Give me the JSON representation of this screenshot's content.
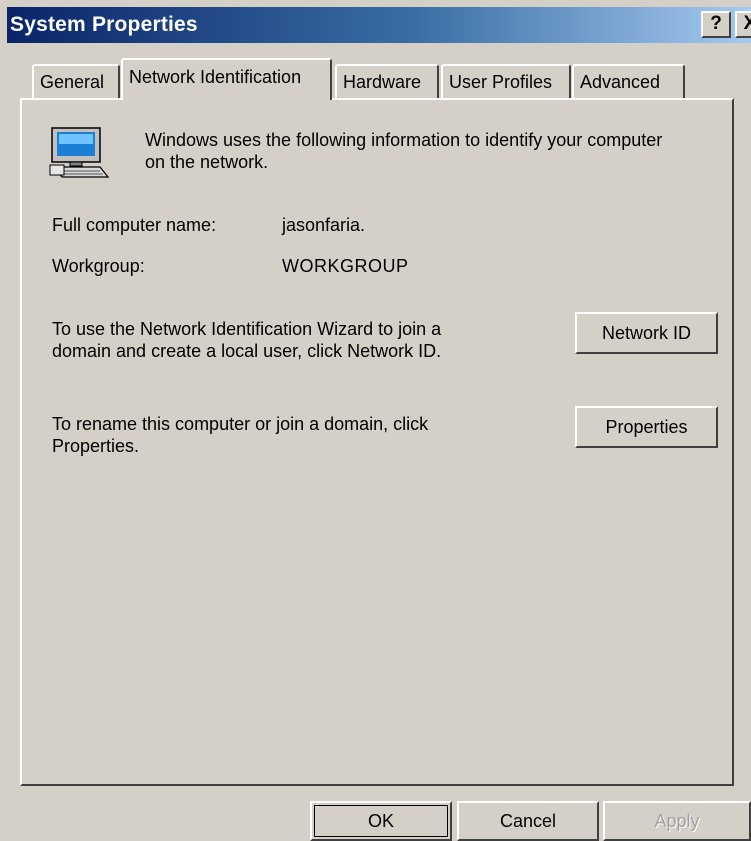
{
  "window": {
    "title": "System Properties",
    "help_glyph": "?",
    "close_glyph": "X"
  },
  "tabs": [
    {
      "label": "General"
    },
    {
      "label": "Network Identification"
    },
    {
      "label": "Hardware"
    },
    {
      "label": "User Profiles"
    },
    {
      "label": "Advanced"
    }
  ],
  "active_tab": "Network Identification",
  "panel": {
    "intro_line1": "Windows uses the following information to identify your computer",
    "intro_line2": "on the network.",
    "full_name_label": "Full computer name:",
    "full_name_value": "jasonfaria.",
    "workgroup_label": "Workgroup:",
    "workgroup_value": "WORKGROUP",
    "wizard_line1": "To use the Network Identification Wizard to join a",
    "wizard_line2": "domain and create a local user, click Network ID.",
    "network_id_button": "Network ID",
    "rename_line1": "To rename this computer or join a domain, click",
    "rename_line2": "Properties.",
    "properties_button": "Properties"
  },
  "footer": {
    "ok": "OK",
    "cancel": "Cancel",
    "apply": "Apply"
  },
  "icons": {
    "computer": "computer-icon"
  },
  "colors": {
    "title_start": "#0a246a",
    "title_end": "#a6caf0",
    "face": "#d4d0c8"
  }
}
